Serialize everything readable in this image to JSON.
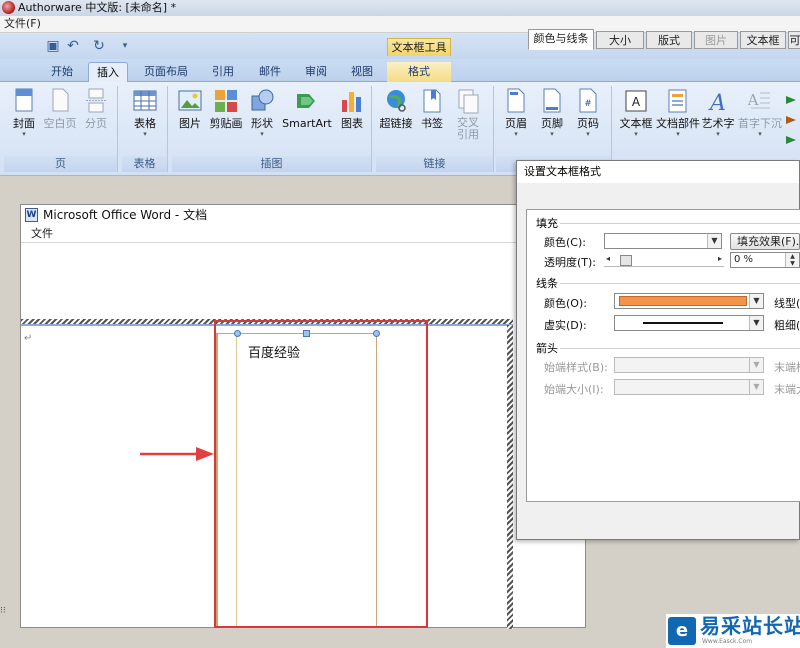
{
  "app": {
    "title": "Authorware 中文版: [未命名] *",
    "menu": "文件(F)"
  },
  "ribbon": {
    "context_header": "文本框工具",
    "tabs": [
      "开始",
      "插入",
      "页面布局",
      "引用",
      "邮件",
      "审阅",
      "视图",
      "格式"
    ],
    "active_tab": "插入",
    "groups": [
      {
        "label": "页",
        "buttons": [
          {
            "label": "封面",
            "icon": "cover-page-icon"
          },
          {
            "label": "空白页",
            "icon": "blank-page-icon"
          },
          {
            "label": "分页",
            "icon": "page-break-icon"
          }
        ]
      },
      {
        "label": "表格",
        "buttons": [
          {
            "label": "表格",
            "icon": "table-icon"
          }
        ]
      },
      {
        "label": "插图",
        "buttons": [
          {
            "label": "图片",
            "icon": "picture-icon"
          },
          {
            "label": "剪贴画",
            "icon": "clipart-icon"
          },
          {
            "label": "形状",
            "icon": "shapes-icon"
          },
          {
            "label": "SmartArt",
            "icon": "smartart-icon"
          },
          {
            "label": "图表",
            "icon": "chart-icon"
          }
        ]
      },
      {
        "label": "链接",
        "buttons": [
          {
            "label": "超链接",
            "icon": "hyperlink-icon"
          },
          {
            "label": "书签",
            "icon": "bookmark-icon"
          },
          {
            "label": "交叉\n引用",
            "icon": "cross-reference-icon"
          }
        ]
      },
      {
        "label": "",
        "buttons": [
          {
            "label": "页眉",
            "icon": "header-icon"
          },
          {
            "label": "页脚",
            "icon": "footer-icon"
          },
          {
            "label": "页码",
            "icon": "page-number-icon"
          }
        ]
      },
      {
        "label": "",
        "buttons": [
          {
            "label": "文本框",
            "icon": "textbox-icon"
          },
          {
            "label": "文档部件",
            "icon": "quick-parts-icon"
          },
          {
            "label": "艺术字",
            "icon": "wordart-icon"
          },
          {
            "label": "首字下沉",
            "icon": "drop-cap-icon"
          }
        ]
      }
    ]
  },
  "word": {
    "title": "Microsoft Office Word  - 文档",
    "menu": "文件",
    "textbox_text": "百度经验"
  },
  "dialog": {
    "title": "设置文本框格式",
    "tabs": [
      "颜色与线条",
      "大小",
      "版式",
      "图片",
      "文本框",
      "可"
    ],
    "fill_section": "填充",
    "color_label": "颜色(C):",
    "fill_effects_button": "填充效果(F)...",
    "transparency_label": "透明度(T):",
    "transparency_value": "0 %",
    "line_section": "线条",
    "line_color_label": "颜色(O):",
    "line_color": "#f4944b",
    "line_style_label": "线型(",
    "dash_label": "虚实(D):",
    "weight_label": "粗细(",
    "arrows_section": "箭头",
    "begin_style_label": "始端样式(B):",
    "end_style_label": "末端样",
    "begin_size_label": "始端大小(I):",
    "end_size_label": "末端大"
  },
  "watermark": {
    "name": "易采站长站",
    "sub": "Www.Easck.Com"
  }
}
